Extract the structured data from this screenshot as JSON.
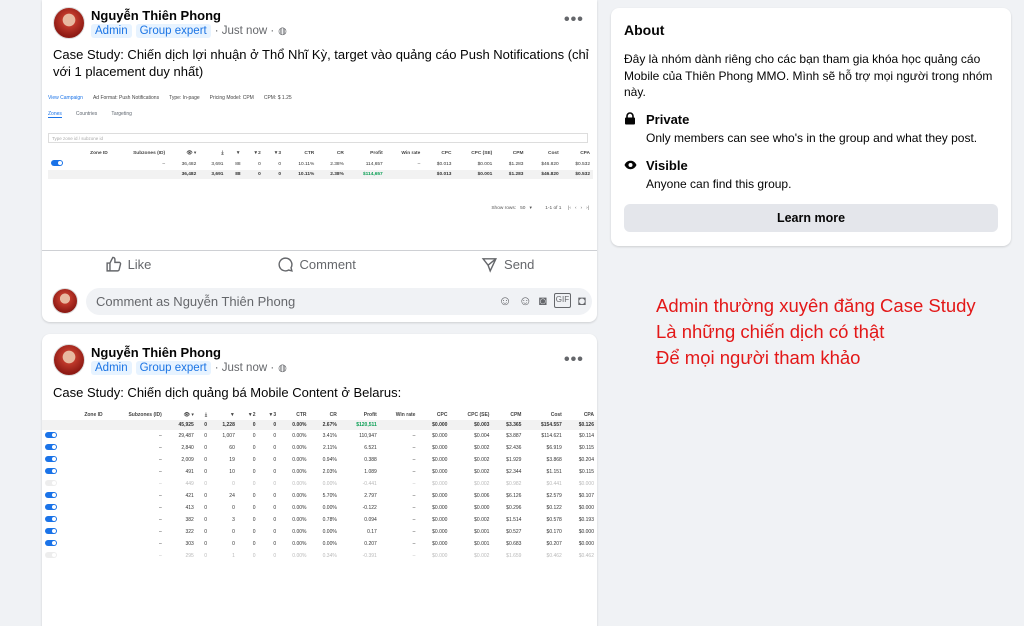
{
  "post1": {
    "author": "Nguyễn Thiên Phong",
    "badge_admin": "Admin",
    "badge_expert": "Group expert",
    "time": "· Just now ·",
    "text": "Case Study: Chiến dịch lợi nhuận ở Thổ Nhĩ Kỳ, target vào quảng cáo Push Notifications (chỉ với 1 placement duy nhất)",
    "shot": {
      "topbar": [
        "View Campaign",
        "Ad Format: Push Notifications",
        "Type: In-page",
        "Pricing Model: CPM",
        "CPM: $ 1.25"
      ],
      "tabs": [
        "Zones",
        "Countries",
        "Targeting"
      ],
      "filter_placeholder": "Type zone id / subzone id",
      "headers": [
        "",
        "Zone ID",
        "Subzones (ID)",
        "👁 ▾",
        "⤓",
        "▼",
        "▼2",
        "▼3",
        "CTR",
        "CR",
        "Profit",
        "Win rate",
        "CPC",
        "CPC (SE)",
        "CPM",
        "Cost",
        "CPA"
      ],
      "rows": [
        [
          "",
          "",
          "–",
          "36,482",
          "3,691",
          "88",
          "0",
          "0",
          "10.11%",
          "2.38%",
          "114,657",
          "–",
          "$0.013",
          "$0.001",
          "$1.283",
          "$46.820",
          "$0.532"
        ]
      ],
      "total": [
        "",
        "",
        "",
        "36,482",
        "3,691",
        "88",
        "0",
        "0",
        "10.11%",
        "2.38%",
        "$114,657",
        "",
        "$0.013",
        "$0.001",
        "$1.283",
        "$46.820",
        "$0.532"
      ],
      "pagination": "Show rows:   50   ▾          1-1 of 1     |‹   ‹   ›   ›|"
    },
    "actions": [
      "Like",
      "Comment",
      "Send"
    ],
    "comment_placeholder": "Comment as Nguyễn Thiên Phong"
  },
  "post2": {
    "author": "Nguyễn Thiên Phong",
    "badge_admin": "Admin",
    "badge_expert": "Group expert",
    "time": "· Just now ·",
    "text": "Case Study: Chiến dịch quảng bá Mobile Content ở Belarus:",
    "shot": {
      "headers": [
        "",
        "Zone ID",
        "Subzones (ID)",
        "👁 ▾",
        "⤓",
        "▼",
        "▼2",
        "▼3",
        "CTR",
        "CR",
        "Profit",
        "Win rate",
        "CPC",
        "CPC (SE)",
        "CPM",
        "Cost",
        "CPA"
      ],
      "total": [
        "",
        "",
        "",
        "45,925",
        "0",
        "1,228",
        "0",
        "0",
        "0.00%",
        "2.67%",
        "$120,511",
        "",
        "$0.000",
        "$0.003",
        "$3.365",
        "$154.557",
        "$0.126"
      ],
      "rows": [
        [
          "on",
          "",
          "–",
          "29,487",
          "0",
          "1,007",
          "0",
          "0",
          "0.00%",
          "3.41%",
          "110,947",
          "–",
          "$0.000",
          "$0.004",
          "$3.887",
          "$114.621",
          "$0.114"
        ],
        [
          "on",
          "",
          "–",
          "2,840",
          "0",
          "60",
          "0",
          "0",
          "0.00%",
          "2.11%",
          "6.521",
          "–",
          "$0.000",
          "$0.002",
          "$2.436",
          "$6.919",
          "$0.115"
        ],
        [
          "on",
          "",
          "–",
          "2,009",
          "0",
          "19",
          "0",
          "0",
          "0.00%",
          "0.94%",
          "0.388",
          "–",
          "$0.000",
          "$0.002",
          "$1.929",
          "$3.868",
          "$0.204"
        ],
        [
          "on",
          "",
          "–",
          "491",
          "0",
          "10",
          "0",
          "0",
          "0.00%",
          "2.03%",
          "1.089",
          "–",
          "$0.000",
          "$0.002",
          "$2.344",
          "$1.151",
          "$0.115"
        ],
        [
          "off",
          "",
          "–",
          "449",
          "0",
          "0",
          "0",
          "0",
          "0.00%",
          "0.00%",
          "-0.441",
          "–",
          "$0.000",
          "$0.002",
          "$0.982",
          "$0.441",
          "$0.000"
        ],
        [
          "on",
          "",
          "–",
          "421",
          "0",
          "24",
          "0",
          "0",
          "0.00%",
          "5.70%",
          "2.797",
          "–",
          "$0.000",
          "$0.006",
          "$6.126",
          "$2.579",
          "$0.107"
        ],
        [
          "on",
          "",
          "–",
          "413",
          "0",
          "0",
          "0",
          "0",
          "0.00%",
          "0.00%",
          "-0.122",
          "–",
          "$0.000",
          "$0.000",
          "$0.296",
          "$0.122",
          "$0.000"
        ],
        [
          "on",
          "",
          "–",
          "382",
          "0",
          "3",
          "0",
          "0",
          "0.00%",
          "0.78%",
          "0.094",
          "–",
          "$0.000",
          "$0.002",
          "$1.514",
          "$0.578",
          "$0.193"
        ],
        [
          "on",
          "",
          "–",
          "322",
          "0",
          "0",
          "0",
          "0",
          "0.00%",
          "0.00%",
          "0.17",
          "–",
          "$0.000",
          "$0.001",
          "$0.527",
          "$0.170",
          "$0.000"
        ],
        [
          "on",
          "",
          "–",
          "303",
          "0",
          "0",
          "0",
          "0",
          "0.00%",
          "0.00%",
          "0.207",
          "–",
          "$0.000",
          "$0.001",
          "$0.683",
          "$0.207",
          "$0.000"
        ],
        [
          "off",
          "",
          "–",
          "295",
          "0",
          "1",
          "0",
          "0",
          "0.00%",
          "0.34%",
          "-0.391",
          "–",
          "$0.000",
          "$0.002",
          "$1.659",
          "$0.462",
          "$0.462"
        ]
      ]
    }
  },
  "about": {
    "title": "About",
    "description": "Đây là nhóm dành riêng cho các bạn tham gia khóa học quảng cáo Mobile của Thiên Phong MMO. Mình sẽ hỗ trợ mọi người trong nhóm này.",
    "private_title": "Private",
    "private_sub": "Only members can see who's in the group and what they post.",
    "visible_title": "Visible",
    "visible_sub": "Anyone can find this group.",
    "learn_more": "Learn more"
  },
  "note": {
    "line1": "Admin thường xuyên đăng Case Study",
    "line2": "Là những chiến dịch có thật",
    "line3": "Để mọi người tham khảo"
  }
}
